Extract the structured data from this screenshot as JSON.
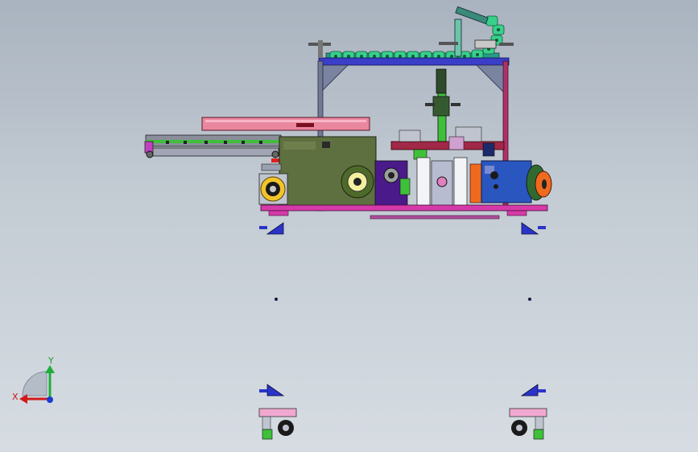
{
  "app": {
    "title": ""
  },
  "triad": {
    "x_label": "X",
    "y_label": "Y",
    "colors": {
      "x": "#d21a1a",
      "y": "#1fae3a",
      "z": "#1a3bd2",
      "label_x": "#c81818",
      "label_y": "#18a030"
    }
  },
  "colors": {
    "background_top": "#a9b3bf",
    "background_bottom": "#d6dce2",
    "frame_blue": "#2a35c8",
    "olive_housing": "#5b6e3c",
    "pink_rail": "#e56f98",
    "green_chain": "#38d08a",
    "magenta_base": "#c83ab0",
    "orange_roller": "#ee6a1e",
    "blue_motor": "#2850b8",
    "yellow_gear": "#f0c020"
  },
  "components": [
    "main-frame",
    "cable-drag-chain",
    "conveyor-belt",
    "upper-rail",
    "gearbox-housing",
    "film-reel",
    "drive-motor",
    "pneumatic-cylinder",
    "left-caster-wheel",
    "right-caster-wheel",
    "mounting-bracket"
  ]
}
